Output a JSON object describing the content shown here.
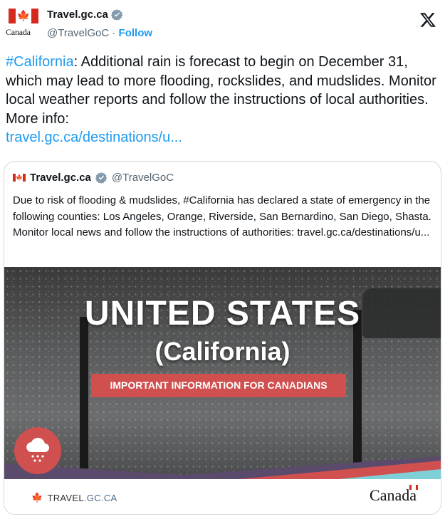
{
  "header": {
    "logo_word": "Canada",
    "name": "Travel.gc.ca",
    "handle": "@TravelGoC",
    "separator": "·",
    "follow": "Follow"
  },
  "tweet": {
    "hashtag": "#California",
    "text": ": Additional rain is forecast to begin on December 31, which may lead to more flooding, rockslides, and mudslides. Monitor local weather reports and follow the instructions of local authorities. More info:",
    "link": "travel.gc.ca/destinations/u..."
  },
  "quote": {
    "name": "Travel.gc.ca",
    "handle": "@TravelGoC",
    "text": "Due to risk of flooding & mudslides, #California has declared a state of emergency in the following counties: Los Angeles, Orange, Riverside, San Bernardino, San Diego, Shasta. Monitor local news and follow the instructions of authorities: travel.gc.ca/destinations/u..."
  },
  "image": {
    "title": "UNITED STATES",
    "subtitle": "(California)",
    "banner": "IMPORTANT INFORMATION FOR CANADIANS",
    "footer_left_travel": "TRAVEL",
    "footer_left_domain": ".GC.CA",
    "footer_right": "Canada"
  },
  "colors": {
    "accent_blue": "#1d9bf0",
    "canada_red": "#d52b1e",
    "banner_red": "#d04f4f",
    "teal": "#7fd0d6"
  }
}
